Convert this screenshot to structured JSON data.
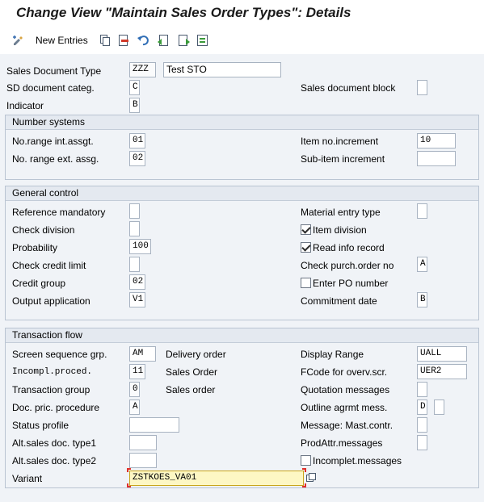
{
  "window": {
    "title": "Change View \"Maintain Sales Order Types\": Details"
  },
  "toolbar": {
    "new_entries_label": "New Entries",
    "icons": [
      "display-change-icon",
      "new-entries-icon",
      "copy-icon",
      "delete-icon",
      "undo-icon",
      "previous-entry-icon",
      "next-entry-icon",
      "select-all-icon"
    ]
  },
  "header": {
    "sales_doc_type_label": "Sales Document Type",
    "sales_doc_type_value": "ZZZ",
    "sales_doc_type_desc": "Test STO",
    "sd_doc_categ_label": "SD document categ.",
    "sd_doc_categ_value": "C",
    "sales_doc_block_label": "Sales document block",
    "sales_doc_block_value": "",
    "indicator_label": "Indicator",
    "indicator_value": "B"
  },
  "number_systems": {
    "title": "Number systems",
    "no_range_int_label": "No.range int.assgt.",
    "no_range_int_value": "01",
    "item_no_incr_label": "Item no.increment",
    "item_no_incr_value": "10",
    "no_range_ext_label": "No. range ext. assg.",
    "no_range_ext_value": "02",
    "sub_item_incr_label": "Sub-item increment",
    "sub_item_incr_value": ""
  },
  "general_control": {
    "title": "General control",
    "ref_mandatory_label": "Reference mandatory",
    "ref_mandatory_value": "",
    "material_entry_type_label": "Material entry type",
    "material_entry_type_value": "",
    "check_division_label": "Check division",
    "check_division_value": "",
    "item_division_label": "Item division",
    "item_division_checked": true,
    "probability_label": "Probability",
    "probability_value": "100",
    "read_info_record_label": "Read info record",
    "read_info_record_checked": true,
    "check_credit_limit_label": "Check credit limit",
    "check_credit_limit_value": "",
    "check_purch_order_label": "Check purch.order no",
    "check_purch_order_value": "A",
    "credit_group_label": "Credit group",
    "credit_group_value": "02",
    "enter_po_number_label": "Enter PO number",
    "enter_po_number_checked": false,
    "output_application_label": "Output application",
    "output_application_value": "V1",
    "commitment_date_label": "Commitment  date",
    "commitment_date_value": "B"
  },
  "transaction_flow": {
    "title": "Transaction flow",
    "screen_seq_label": "Screen sequence grp.",
    "screen_seq_value": "AM",
    "screen_seq_desc": "Delivery order",
    "display_range_label": "Display Range",
    "display_range_value": "UALL",
    "incompl_proced_label": "Incompl.proced.",
    "incompl_proced_value": "11",
    "incompl_proced_desc": "Sales Order",
    "fcode_overv_label": "FCode for overv.scr.",
    "fcode_overv_value": "UER2",
    "transaction_group_label": "Transaction group",
    "transaction_group_value": "0",
    "transaction_group_desc": "Sales order",
    "quotation_messages_label": "Quotation messages",
    "quotation_messages_value": "",
    "doc_pric_proc_label": "Doc. pric. procedure",
    "doc_pric_proc_value": "A",
    "outline_agrmt_label": "Outline agrmt mess.",
    "outline_agrmt_value": "D",
    "outline_agrmt_value2": "",
    "status_profile_label": "Status profile",
    "status_profile_value": "",
    "message_mast_contr_label": "Message: Mast.contr.",
    "message_mast_contr_value": "",
    "alt_sales_doc1_label": "Alt.sales doc. type1",
    "alt_sales_doc1_value": "",
    "prodattr_messages_label": "ProdAttr.messages",
    "prodattr_messages_value": "",
    "alt_sales_doc2_label": "Alt.sales doc. type2",
    "alt_sales_doc2_value": "",
    "incomplet_messages_label": "Incomplet.messages",
    "incomplet_messages_checked": false,
    "variant_label": "Variant",
    "variant_value": "ZSTKOES_VA01"
  }
}
